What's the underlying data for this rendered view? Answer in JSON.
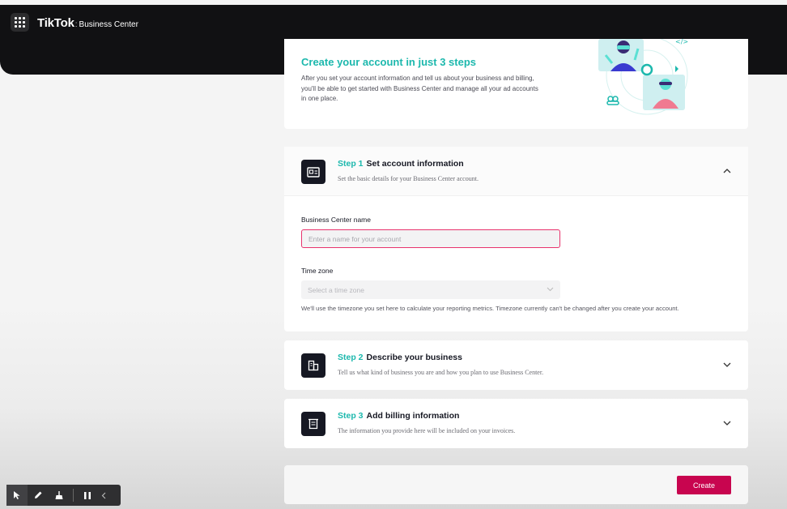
{
  "header": {
    "logo": "TikTok",
    "separator": ":",
    "product": "Business Center"
  },
  "hero": {
    "title": "Create your account in just 3 steps",
    "description": "After you set your account information and tell us about your business and billing, you'll be able to get started with Business Center and manage all your ad accounts in one place."
  },
  "steps": [
    {
      "number": "Step 1",
      "title": "Set account information",
      "subtitle": "Set the basic details for your Business Center account.",
      "icon": "id-card-icon",
      "expanded": true
    },
    {
      "number": "Step 2",
      "title": "Describe your business",
      "subtitle": "Tell us what kind of business you are and how you plan to use Business Center.",
      "icon": "building-icon",
      "expanded": false
    },
    {
      "number": "Step 3",
      "title": "Add billing information",
      "subtitle": "The information you provide here will be included on your invoices.",
      "icon": "invoice-icon",
      "expanded": false
    }
  ],
  "form": {
    "business_name_label": "Business Center name",
    "business_name_placeholder": "Enter a name for your account",
    "business_name_value": "",
    "timezone_label": "Time zone",
    "timezone_placeholder": "Select a time zone",
    "timezone_note": "We'll use the timezone you set here to calculate your reporting metrics. Timezone currently can't be changed after you create your account."
  },
  "footer": {
    "create_label": "Create"
  },
  "colors": {
    "accent_teal": "#1cb8ad",
    "primary_pink": "#c8054f",
    "input_focus": "#e8336d",
    "topbar": "#111113"
  }
}
